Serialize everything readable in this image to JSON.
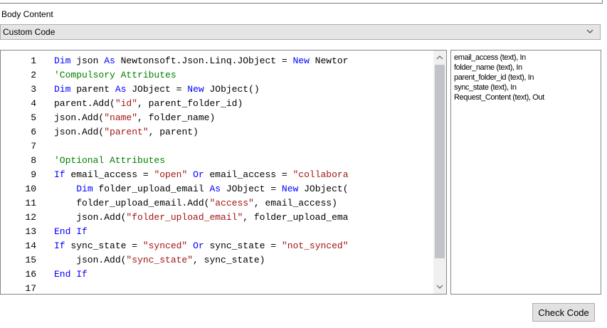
{
  "section_label": "Body Content",
  "dropdown": {
    "selected": "Custom Code"
  },
  "code_lines": [
    {
      "num": "1",
      "tokens": [
        {
          "c": "kw",
          "t": "Dim"
        },
        {
          "c": "",
          "t": " json "
        },
        {
          "c": "kw",
          "t": "As"
        },
        {
          "c": "",
          "t": " Newtonsoft.Json.Linq.JObject = "
        },
        {
          "c": "kw",
          "t": "New"
        },
        {
          "c": "",
          "t": " Newtor"
        }
      ]
    },
    {
      "num": "2",
      "tokens": [
        {
          "c": "cm",
          "t": "'Compulsory Attributes"
        }
      ]
    },
    {
      "num": "3",
      "tokens": [
        {
          "c": "kw",
          "t": "Dim"
        },
        {
          "c": "",
          "t": " parent "
        },
        {
          "c": "kw",
          "t": "As"
        },
        {
          "c": "",
          "t": " JObject = "
        },
        {
          "c": "kw",
          "t": "New"
        },
        {
          "c": "",
          "t": " JObject()"
        }
      ]
    },
    {
      "num": "4",
      "tokens": [
        {
          "c": "",
          "t": "parent.Add("
        },
        {
          "c": "str",
          "t": "\"id\""
        },
        {
          "c": "",
          "t": ", parent_folder_id)"
        }
      ]
    },
    {
      "num": "5",
      "tokens": [
        {
          "c": "",
          "t": "json.Add("
        },
        {
          "c": "str",
          "t": "\"name\""
        },
        {
          "c": "",
          "t": ", folder_name)"
        }
      ]
    },
    {
      "num": "6",
      "tokens": [
        {
          "c": "",
          "t": "json.Add("
        },
        {
          "c": "str",
          "t": "\"parent\""
        },
        {
          "c": "",
          "t": ", parent)"
        }
      ]
    },
    {
      "num": "7",
      "tokens": []
    },
    {
      "num": "8",
      "tokens": [
        {
          "c": "cm",
          "t": "'Optional Attributes"
        }
      ]
    },
    {
      "num": "9",
      "tokens": [
        {
          "c": "kw",
          "t": "If"
        },
        {
          "c": "",
          "t": " email_access = "
        },
        {
          "c": "str",
          "t": "\"open\""
        },
        {
          "c": "",
          "t": " "
        },
        {
          "c": "kw",
          "t": "Or"
        },
        {
          "c": "",
          "t": " email_access = "
        },
        {
          "c": "str",
          "t": "\"collabora"
        }
      ]
    },
    {
      "num": "10",
      "tokens": [
        {
          "c": "",
          "t": "    "
        },
        {
          "c": "kw",
          "t": "Dim"
        },
        {
          "c": "",
          "t": " folder_upload_email "
        },
        {
          "c": "kw",
          "t": "As"
        },
        {
          "c": "",
          "t": " JObject = "
        },
        {
          "c": "kw",
          "t": "New"
        },
        {
          "c": "",
          "t": " JObject("
        }
      ]
    },
    {
      "num": "11",
      "tokens": [
        {
          "c": "",
          "t": "    folder_upload_email.Add("
        },
        {
          "c": "str",
          "t": "\"access\""
        },
        {
          "c": "",
          "t": ", email_access)"
        }
      ]
    },
    {
      "num": "12",
      "tokens": [
        {
          "c": "",
          "t": "    json.Add("
        },
        {
          "c": "str",
          "t": "\"folder_upload_email\""
        },
        {
          "c": "",
          "t": ", folder_upload_ema"
        }
      ]
    },
    {
      "num": "13",
      "tokens": [
        {
          "c": "kw",
          "t": "End If"
        }
      ]
    },
    {
      "num": "14",
      "tokens": [
        {
          "c": "kw",
          "t": "If"
        },
        {
          "c": "",
          "t": " sync_state = "
        },
        {
          "c": "str",
          "t": "\"synced\""
        },
        {
          "c": "",
          "t": " "
        },
        {
          "c": "kw",
          "t": "Or"
        },
        {
          "c": "",
          "t": " sync_state = "
        },
        {
          "c": "str",
          "t": "\"not_synced\""
        }
      ]
    },
    {
      "num": "15",
      "tokens": [
        {
          "c": "",
          "t": "    json.Add("
        },
        {
          "c": "str",
          "t": "\"sync_state\""
        },
        {
          "c": "",
          "t": ", sync_state)"
        }
      ]
    },
    {
      "num": "16",
      "tokens": [
        {
          "c": "kw",
          "t": "End If"
        }
      ]
    },
    {
      "num": "17",
      "tokens": []
    }
  ],
  "parameters": [
    "email_access (text), In",
    "folder_name (text), In",
    "parent_folder_id (text), In",
    "sync_state (text), In",
    "Request_Content (text), Out"
  ],
  "check_button_label": "Check Code",
  "icons": {
    "dropdown": "chevron-down-icon",
    "scroll_up": "arrow-up-icon",
    "scroll_down": "arrow-down-icon"
  }
}
